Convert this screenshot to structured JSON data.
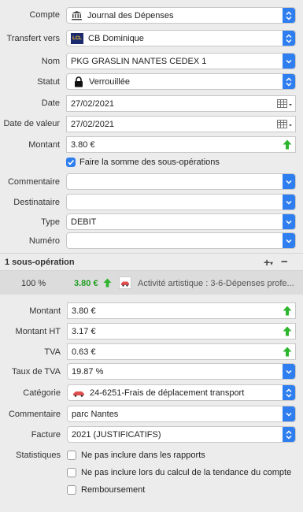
{
  "form": {
    "compte": {
      "label": "Compte",
      "value": "Journal des Dépenses"
    },
    "transfert": {
      "label": "Transfert vers",
      "value": "CB Dominique",
      "badge": "LCL"
    },
    "nom": {
      "label": "Nom",
      "value": "PKG GRASLIN NANTES CEDEX 1"
    },
    "statut": {
      "label": "Statut",
      "value": "Verrouillée"
    },
    "date": {
      "label": "Date",
      "value": "27/02/2021"
    },
    "date_valeur": {
      "label": "Date de valeur",
      "value": "27/02/2021"
    },
    "montant": {
      "label": "Montant",
      "value": "3.80 €"
    },
    "somme_sous_ops": {
      "label": "Faire la somme des sous-opérations",
      "checked": true
    },
    "commentaire": {
      "label": "Commentaire",
      "value": ""
    },
    "destinataire": {
      "label": "Destinataire",
      "value": ""
    },
    "type": {
      "label": "Type",
      "value": "DEBIT"
    },
    "numero": {
      "label": "Numéro",
      "value": ""
    }
  },
  "sous_operations": {
    "header": "1 sous-opération",
    "add_label": "+",
    "remove_label": "−",
    "item": {
      "percent": "100 %",
      "amount": "3.80 €",
      "category": "Activité artistique : 3-6-Dépenses profe..."
    }
  },
  "detail": {
    "montant": {
      "label": "Montant",
      "value": "3.80 €"
    },
    "montant_ht": {
      "label": "Montant HT",
      "value": "3.17 €"
    },
    "tva": {
      "label": "TVA",
      "value": "0.63 €"
    },
    "taux_tva": {
      "label": "Taux de TVA",
      "value": "19.87 %"
    },
    "categorie": {
      "label": "Catégorie",
      "value": "24-6251-Frais de déplacement transport"
    },
    "commentaire": {
      "label": "Commentaire",
      "value": "parc Nantes"
    },
    "facture": {
      "label": "Facture",
      "value": "2021 (JUSTIFICATIFS)"
    },
    "statistiques": {
      "label": "Statistiques",
      "options": [
        {
          "label": "Ne pas inclure dans les rapports",
          "checked": false
        },
        {
          "label": "Ne pas inclure lors du calcul de la tendance du compte",
          "checked": false
        },
        {
          "label": "Remboursement",
          "checked": false
        }
      ]
    }
  },
  "colors": {
    "accent": "#2f7ef0",
    "green": "#2db52d",
    "amount_green": "#1f9e1f"
  }
}
